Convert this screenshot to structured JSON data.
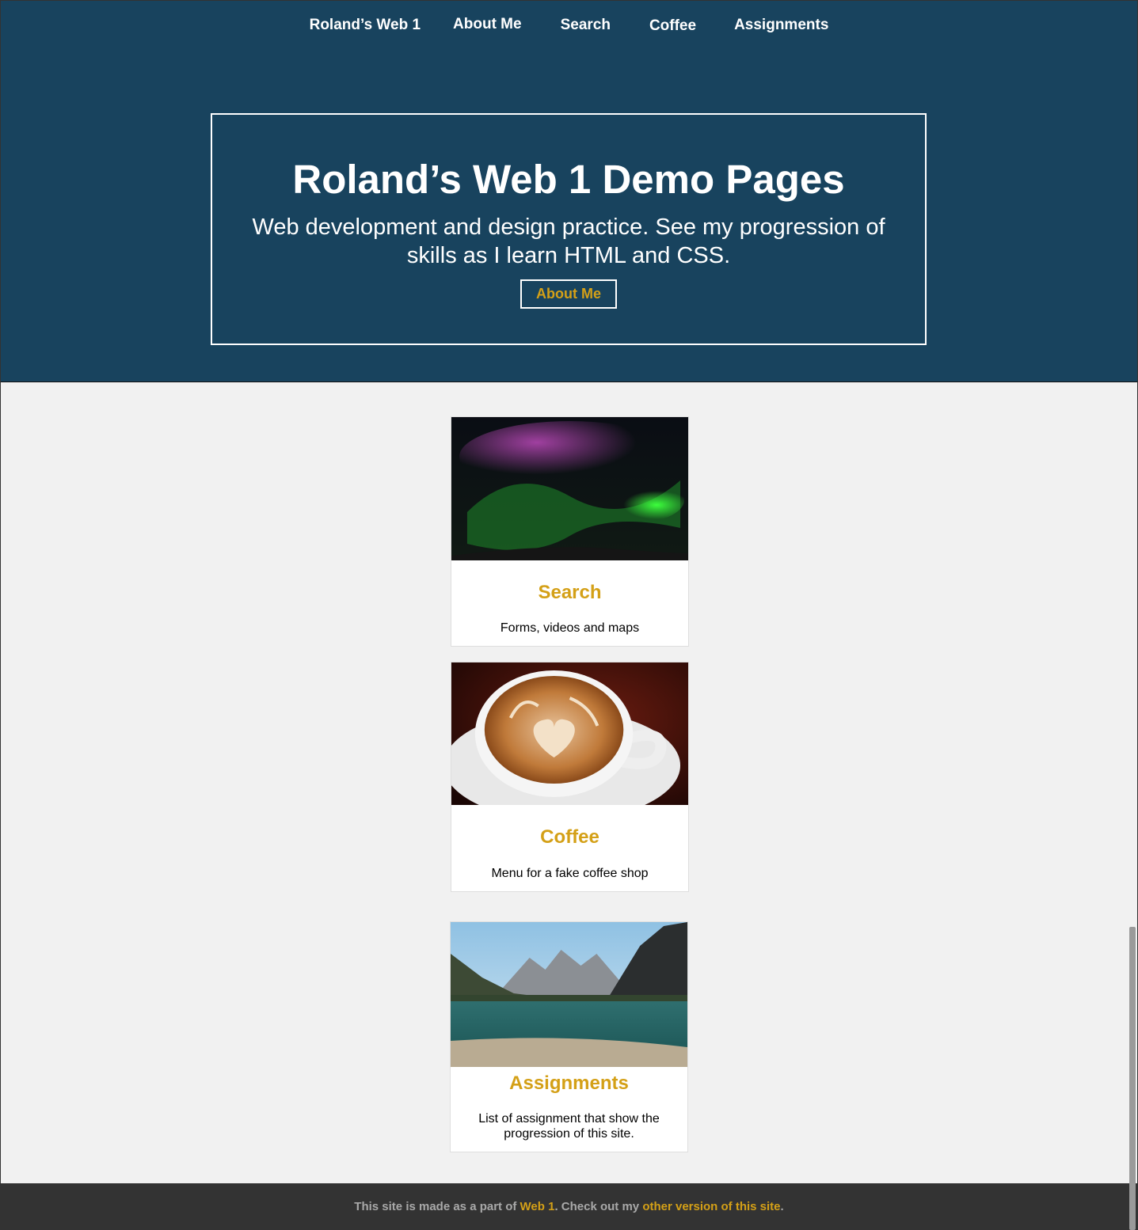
{
  "nav": {
    "home": "Roland’s Web 1",
    "about": "About Me",
    "search": "Search",
    "coffee": "Coffee",
    "assignments": "Assignments"
  },
  "hero": {
    "title": "Roland’s Web 1 Demo Pages",
    "subtitle": "Web development and design practice. See my progression of skills as I learn HTML and CSS.",
    "button": "About Me"
  },
  "cards": [
    {
      "title": "Search",
      "description": "Forms, videos and maps",
      "image": "aurora-image"
    },
    {
      "title": "Coffee",
      "description": "Menu for a fake coffee shop",
      "image": "latte-image"
    },
    {
      "title": "Assignments",
      "description": "List of assignment that show the progression of this site.",
      "image": "mountain-lake-image"
    }
  ],
  "footer": {
    "prefix": "This site is made as a part of ",
    "link1": "Web 1",
    "middle": ". Check out my ",
    "link2": "other version of this site",
    "suffix": "."
  },
  "colors": {
    "header_bg": "#18435e",
    "accent": "#d4a017",
    "page_bg": "#f1f1f1",
    "footer_bg": "#333333"
  }
}
